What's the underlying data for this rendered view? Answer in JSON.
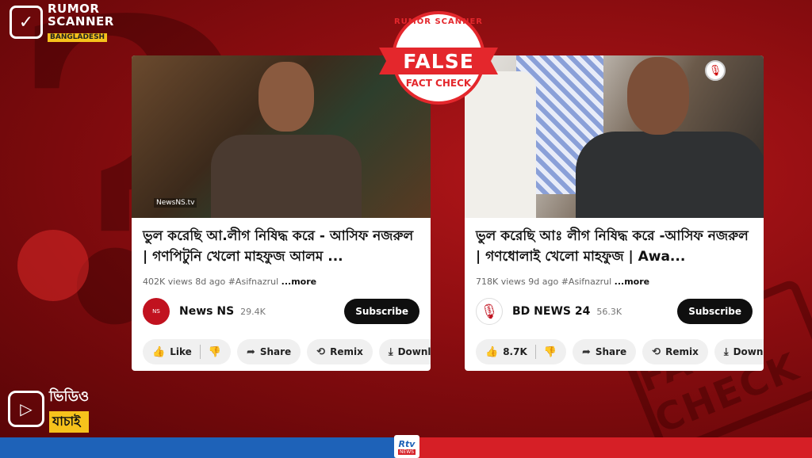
{
  "brand": {
    "line1": "RUMOR",
    "line2": "SCANNER",
    "line3": "BANGLADESH"
  },
  "stamp": {
    "top": "RUMOR SCANNER",
    "band": "FALSE",
    "bottom": "FACT CHECK"
  },
  "left_card": {
    "watermark": "NewsNS.tv",
    "title": "ভুল করেছি আ.লীগ নিষিদ্ধ করে - আসিফ নজরুল | গণপিটুনি খেলো মাহফুজ আলম ...",
    "views": "402K views",
    "age": "8d ago",
    "hashtag": "#Asifnazrul",
    "more": "...more",
    "channel_name": "News NS",
    "subscribers": "29.4K",
    "subscribe": "Subscribe",
    "like": "Like",
    "share": "Share",
    "remix": "Remix",
    "download": "Downlo"
  },
  "right_card": {
    "watermark": "",
    "title": "ভুল করেছি আঃ লীগ নিষিদ্ধ করে -আসিফ নজরুল |  গণধোলাই খেলো মাহফুজ | Awa...",
    "views": "718K views",
    "age": "9d ago",
    "hashtag": "#Asifnazrul",
    "more": "...more",
    "channel_name": "BD NEWS 24",
    "subscribers": "56.3K",
    "subscribe": "Subscribe",
    "like": "8.7K",
    "share": "Share",
    "remix": "Remix",
    "download": "Downl"
  },
  "video_badge": {
    "line1": "ভিডিও",
    "line2": "যাচাই"
  },
  "background_stamp": "FACT CHECK",
  "footer": {
    "logo": "Rtv",
    "news": "NEWS"
  },
  "colors": {
    "background_red": "#8c0d10",
    "stamp_red": "#e4272c",
    "footer_blue": "#1e62b8",
    "footer_red": "#d61f26",
    "badge_yellow": "#f6c21c"
  }
}
